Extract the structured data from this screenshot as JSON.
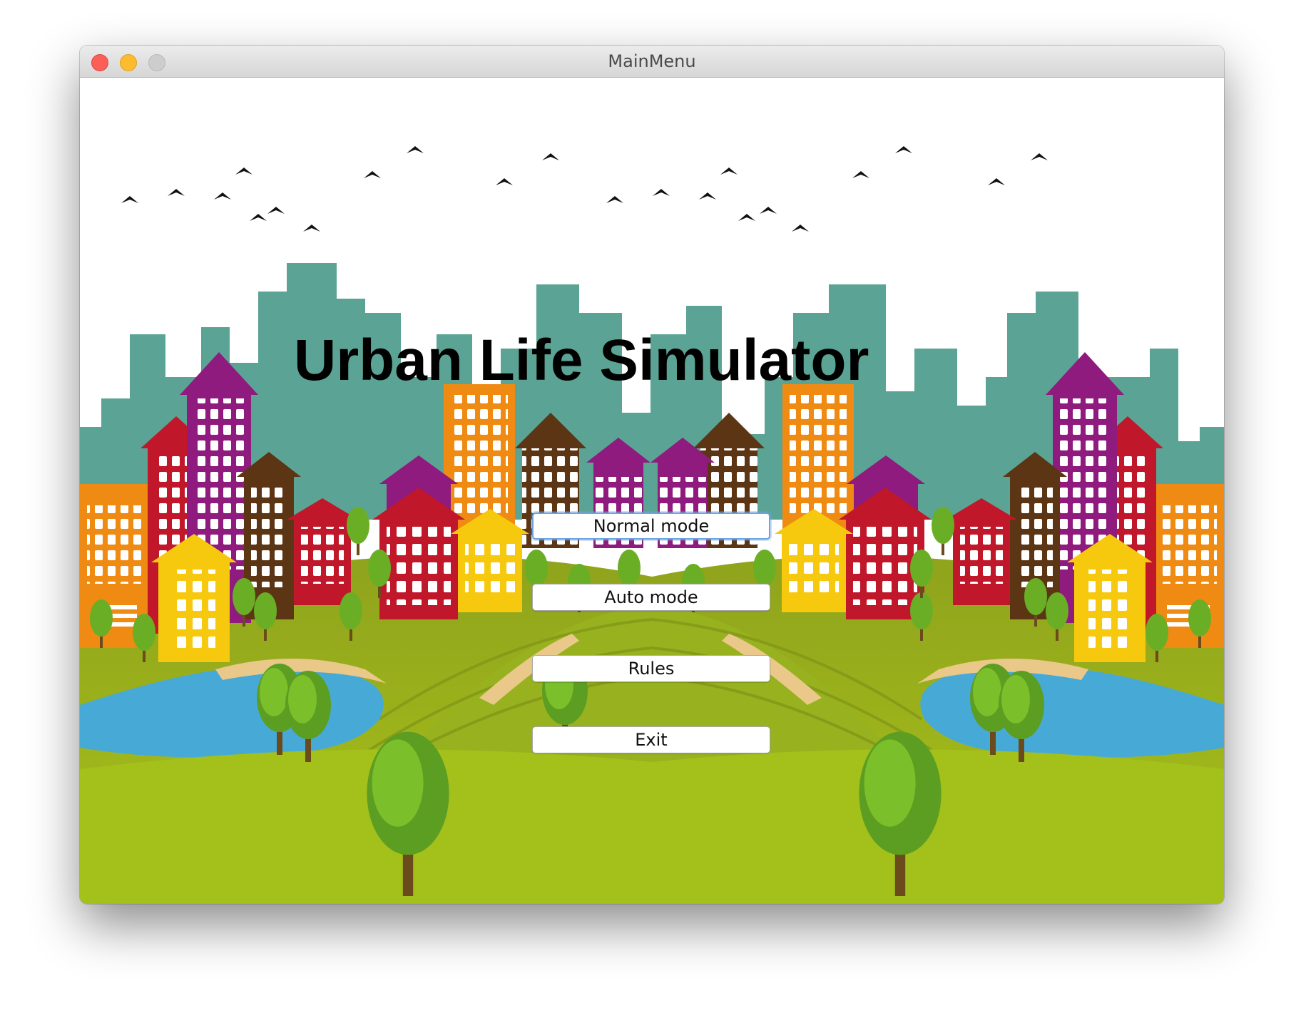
{
  "window": {
    "title": "MainMenu"
  },
  "app": {
    "title": "Urban Life Simulator"
  },
  "menu": {
    "normal_label": "Normal mode",
    "auto_label": "Auto mode",
    "rules_label": "Rules",
    "exit_label": "Exit",
    "focused": "Normal mode"
  },
  "icons": {
    "close": "close-traffic-light-icon",
    "minimize": "minimize-traffic-light-icon",
    "maximize": "maximize-traffic-light-icon"
  },
  "colors": {
    "sky": "#ffffff",
    "skyline_teal": "#5ba495",
    "grass": "#9ab81f",
    "water": "#47aad6",
    "building_orange": "#ef8a12",
    "building_purple": "#8e1b7d",
    "building_red": "#c0172a",
    "building_brown": "#5c3514",
    "building_yellow": "#f7c90e"
  }
}
